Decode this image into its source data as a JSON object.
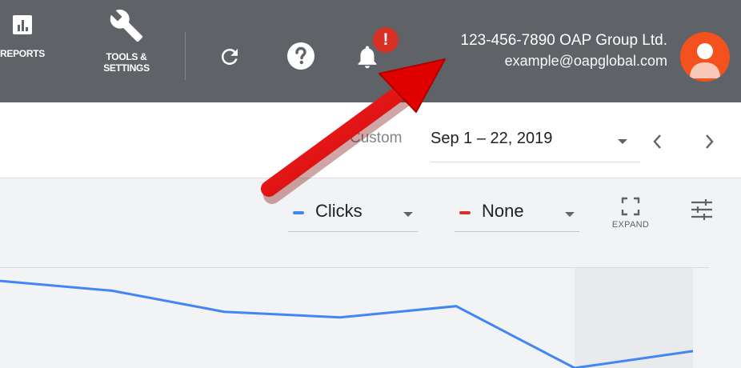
{
  "header": {
    "reports_label": "REPORTS",
    "tools_label_line1": "TOOLS &",
    "tools_label_line2": "SETTINGS",
    "icons": [
      "reports-icon",
      "wrench-icon",
      "refresh-icon",
      "help-icon",
      "notifications-bell-icon",
      "alert-badge-icon"
    ],
    "alert_badge": "!",
    "account": {
      "customer_id_name": "123-456-7890 OAP Group Ltd.",
      "email": "example@oapglobal.com"
    },
    "background_color": "#5f6368",
    "avatar_color": "#f4511e",
    "badge_color": "#d93025"
  },
  "date_bar": {
    "custom_label": "Custom",
    "date_range": "Sep 1 – 22, 2019",
    "icons": [
      "caret-down-icon",
      "chevron-left-icon",
      "chevron-right-icon"
    ]
  },
  "chart_controls": {
    "metric1": {
      "label": "Clicks",
      "color": "#4285f4"
    },
    "metric2": {
      "label": "None",
      "color": "#d93025"
    },
    "expand_label": "EXPAND",
    "icons": [
      "expand-icon",
      "adjust-icon"
    ]
  },
  "chart_data": {
    "type": "line",
    "series": [
      {
        "values": [
          62,
          55,
          40,
          36,
          44,
          0,
          12
        ]
      }
    ],
    "ylim": [
      0,
      70
    ],
    "highlight_last_segment": true,
    "color": "#4285f4"
  }
}
